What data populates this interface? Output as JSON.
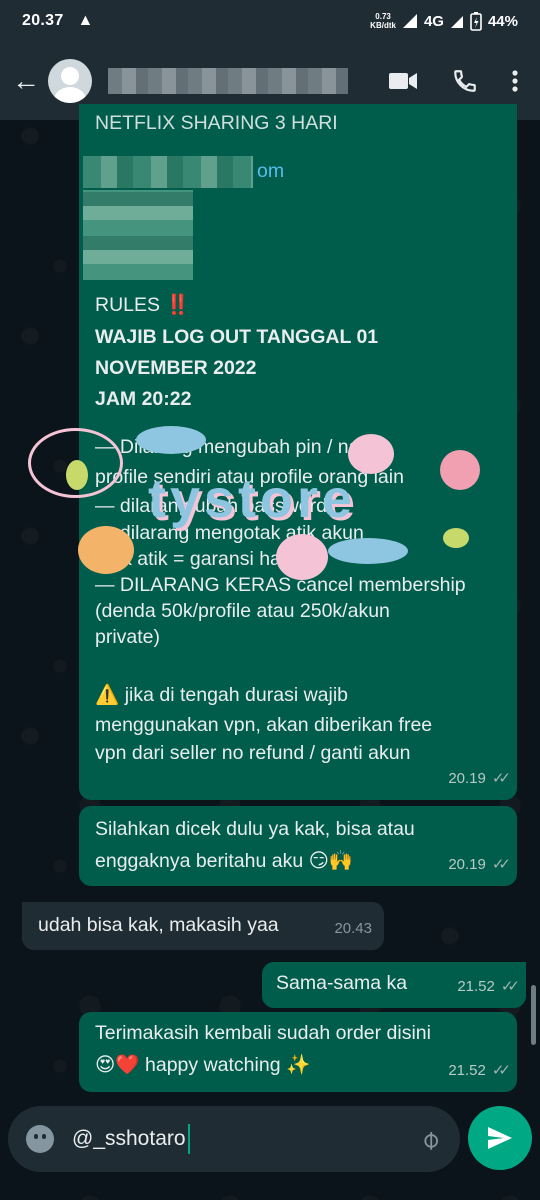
{
  "status_bar": {
    "time": "20.37",
    "warning_icon": "warning-icon",
    "net_speed_value": "0.73",
    "net_speed_unit": "KB/dtk",
    "network": "4G",
    "battery": "44%"
  },
  "header": {
    "back_icon": "arrow-left-icon",
    "contact_name": "",
    "actions": [
      "video-call-icon",
      "phone-icon",
      "more-vert-icon"
    ]
  },
  "messages": {
    "m1": {
      "title_partial": "NETFLIX SHARING 3 HARI",
      "email_partial": "om",
      "rules_label": "RULES",
      "rules_emoji": "‼️",
      "bold_line1": "WAJIB LOG OUT TANGGAL 01",
      "bold_line2": "NOVEMBER 2022",
      "bold_line3": "JAM 20:22",
      "rule1a": "— Dilarang mengubah pin / nama",
      "rule1b": "profile sendiri atau profile orang lain",
      "rule2": "— dilarang ubah password",
      "rule3": "— dilarang mengotak atik akun",
      "rule4": "otak atik = garansi hangus",
      "rule5": "— DILARANG KERAS cancel membership",
      "rule6": "(denda 50k/profile atau 250k/akun",
      "rule7": "private)",
      "warn_emoji": "⚠️",
      "warn1": "jika di tengah durasi wajib",
      "warn2": "menggunakan vpn, akan diberikan free",
      "warn3": "vpn dari seller no refund / ganti akun",
      "time": "20.19",
      "ticks": "✓✓"
    },
    "m2": {
      "line1": "Silahkan dicek dulu ya kak, bisa atau",
      "line2": "enggaknya beritahu aku 😏🙌",
      "time": "20.19",
      "ticks": "✓✓"
    },
    "m3": {
      "line1": "udah bisa kak, makasih yaa",
      "time": "20.43"
    },
    "m4": {
      "line1": "Sama-sama ka",
      "time": "21.52",
      "ticks": "✓✓"
    },
    "m5": {
      "line1": "Terimakasih kembali sudah order disini",
      "line2": "😍❤️ happy watching ✨",
      "time": "21.52",
      "ticks": "✓✓"
    }
  },
  "sticker": {
    "text": "tystore"
  },
  "composer": {
    "text": "@_sshotaro",
    "emoji_icon": "emoji-icon",
    "attach_icon": "paperclip-icon",
    "send_icon": "send-icon"
  },
  "colors": {
    "outgoing_bubble": "#005c4b",
    "incoming_bubble": "#202c33",
    "accent": "#00a884",
    "background": "#0b141a"
  }
}
